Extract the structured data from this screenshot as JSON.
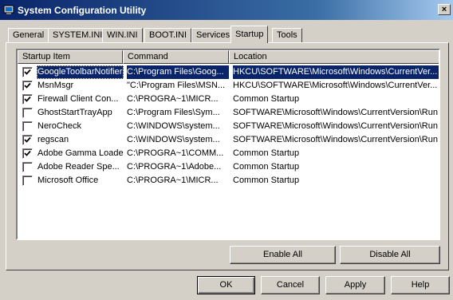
{
  "window": {
    "title": "System Configuration Utility",
    "close_glyph": "×"
  },
  "tabs": [
    {
      "label": "General"
    },
    {
      "label": "SYSTEM.INI"
    },
    {
      "label": "WIN.INI"
    },
    {
      "label": "BOOT.INI"
    },
    {
      "label": "Services"
    },
    {
      "label": "Startup",
      "active": true
    },
    {
      "label": "Tools"
    }
  ],
  "list": {
    "columns": [
      "Startup Item",
      "Command",
      "Location"
    ],
    "rows": [
      {
        "item": "GoogleToolbarNotifier",
        "command": "C:\\Program Files\\Goog...",
        "location": "HKCU\\SOFTWARE\\Microsoft\\Windows\\CurrentVer...",
        "checked": true,
        "selected": true
      },
      {
        "item": "MsnMsgr",
        "command": "\"C:\\Program Files\\MSN...",
        "location": "HKCU\\SOFTWARE\\Microsoft\\Windows\\CurrentVer...",
        "checked": true
      },
      {
        "item": "Firewall Client Con...",
        "command": "C:\\PROGRA~1\\MICR...",
        "location": "Common Startup",
        "checked": true
      },
      {
        "item": "GhostStartTrayApp",
        "command": "C:\\Program Files\\Sym...",
        "location": "SOFTWARE\\Microsoft\\Windows\\CurrentVersion\\Run",
        "checked": false
      },
      {
        "item": "NeroCheck",
        "command": "C:\\WINDOWS\\system...",
        "location": "SOFTWARE\\Microsoft\\Windows\\CurrentVersion\\Run",
        "checked": false
      },
      {
        "item": "regscan",
        "command": "C:\\WINDOWS\\system...",
        "location": "SOFTWARE\\Microsoft\\Windows\\CurrentVersion\\Run",
        "checked": true
      },
      {
        "item": "Adobe Gamma Loader",
        "command": "C:\\PROGRA~1\\COMM...",
        "location": "Common Startup",
        "checked": true
      },
      {
        "item": "Adobe Reader Spe...",
        "command": "C:\\PROGRA~1\\Adobe...",
        "location": "Common Startup",
        "checked": false
      },
      {
        "item": "Microsoft Office",
        "command": "C:\\PROGRA~1\\MICR...",
        "location": "Common Startup",
        "checked": false
      }
    ]
  },
  "buttons": {
    "enable_all": "Enable All",
    "disable_all": "Disable All",
    "ok": "OK",
    "cancel": "Cancel",
    "apply": "Apply",
    "help": "Help"
  },
  "colors": {
    "title_start": "#0a246a",
    "title_end": "#a6caf0",
    "face": "#d4d0c8",
    "selection": "#0a246a"
  }
}
